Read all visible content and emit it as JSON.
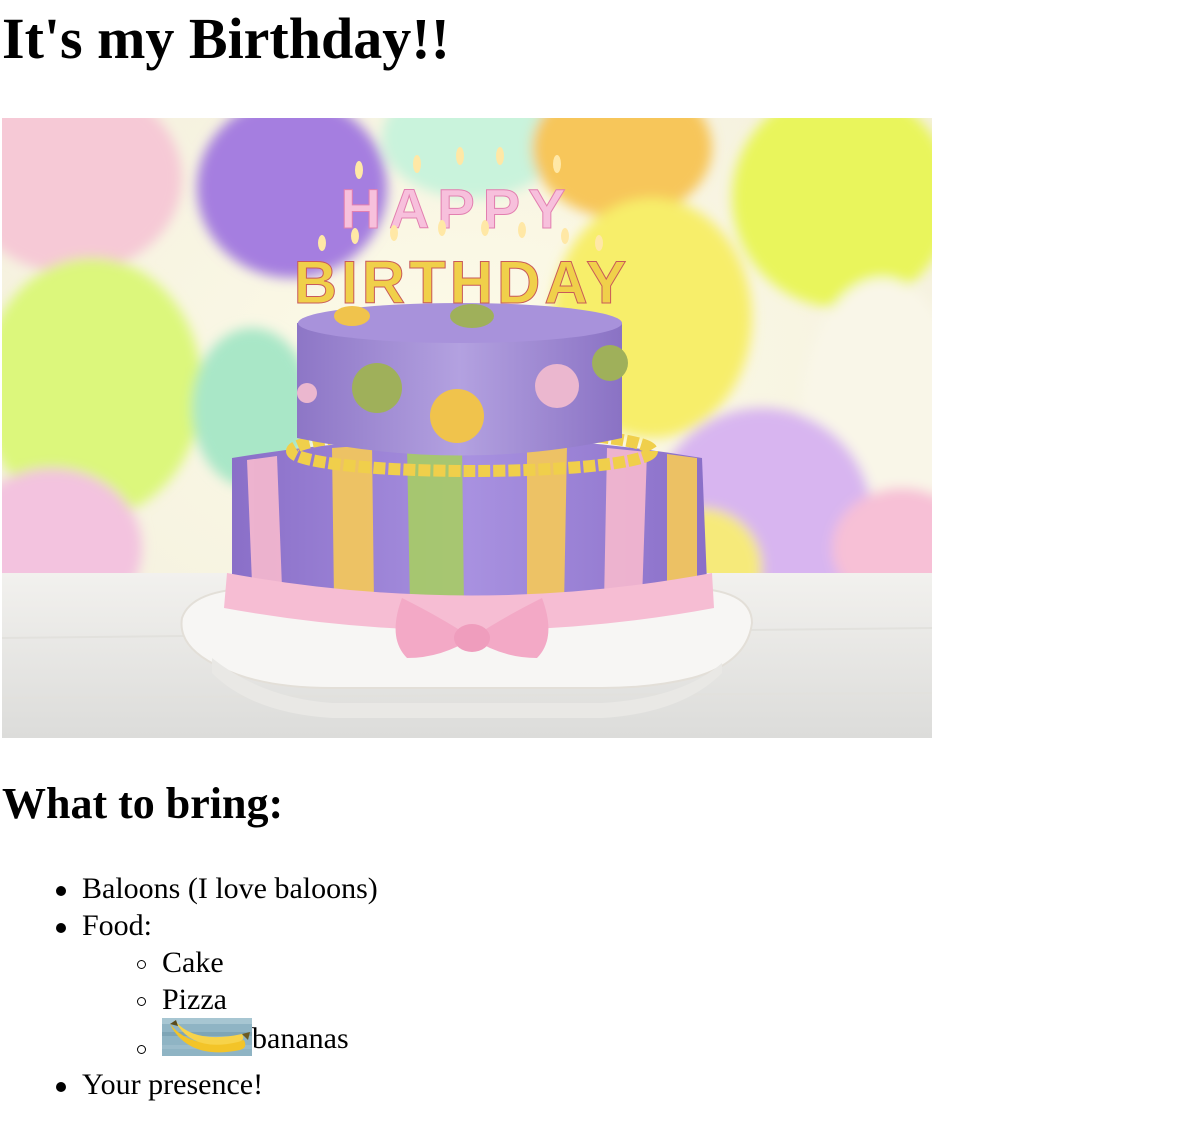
{
  "page": {
    "title": "It's my Birthday!!",
    "subtitle": "What to bring:"
  },
  "hero_image": {
    "candle_letters_top": "HAPPY",
    "candle_letters_bottom": "BIRTHDAY"
  },
  "list": {
    "items": [
      {
        "label": "Baloons (I love baloons)"
      },
      {
        "label": "Food:",
        "subitems": [
          {
            "label": "Cake"
          },
          {
            "label": "Pizza"
          },
          {
            "label": "bananas",
            "has_image": true
          }
        ]
      },
      {
        "label": "Your presence!"
      }
    ]
  }
}
